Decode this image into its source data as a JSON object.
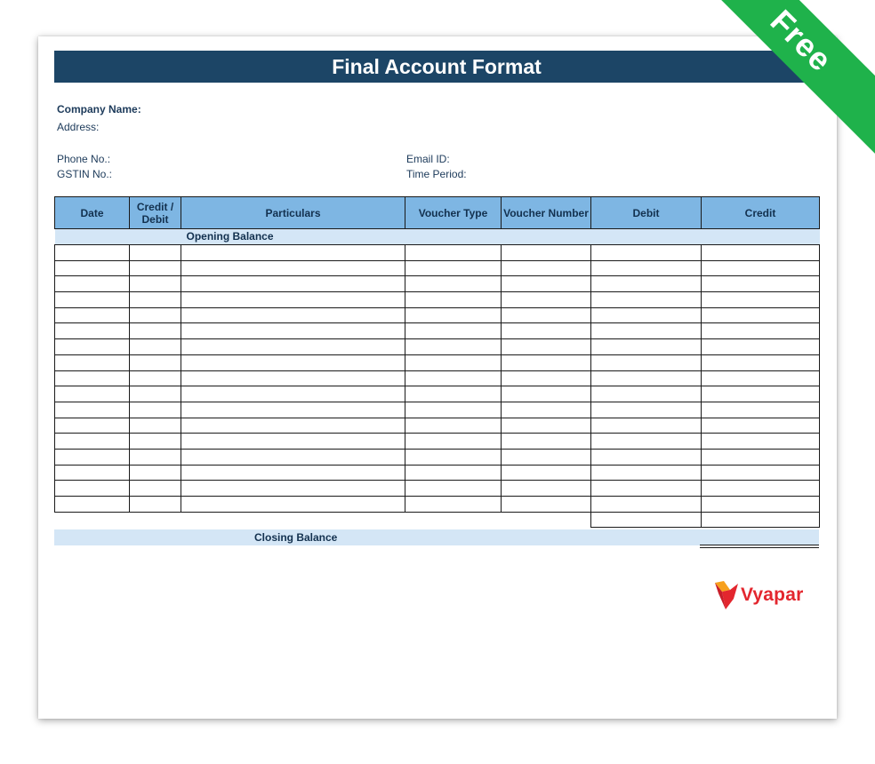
{
  "title": "Final Account Format",
  "company": {
    "name_label": "Company Name:",
    "address_label": "Address:",
    "phone_label": "Phone No.:",
    "gstin_label": "GSTIN No.:",
    "email_label": "Email ID:",
    "period_label": "Time Period:"
  },
  "table": {
    "headers": {
      "date": "Date",
      "credit_debit": "Credit / Debit",
      "particulars": "Particulars",
      "voucher_type": "Voucher Type",
      "voucher_number": "Voucher Number",
      "debit": "Debit",
      "credit": "Credit"
    },
    "opening_balance_label": "Opening Balance",
    "closing_balance_label": "Closing Balance"
  },
  "brand": {
    "logo_text": "Vyapar",
    "ribbon_text": "Free",
    "colors": {
      "title_bar": "#1c4566",
      "header": "#7eb6e3",
      "band": "#d4e6f6",
      "logo": "#e3262e",
      "ribbon": "#1fb24b"
    }
  }
}
